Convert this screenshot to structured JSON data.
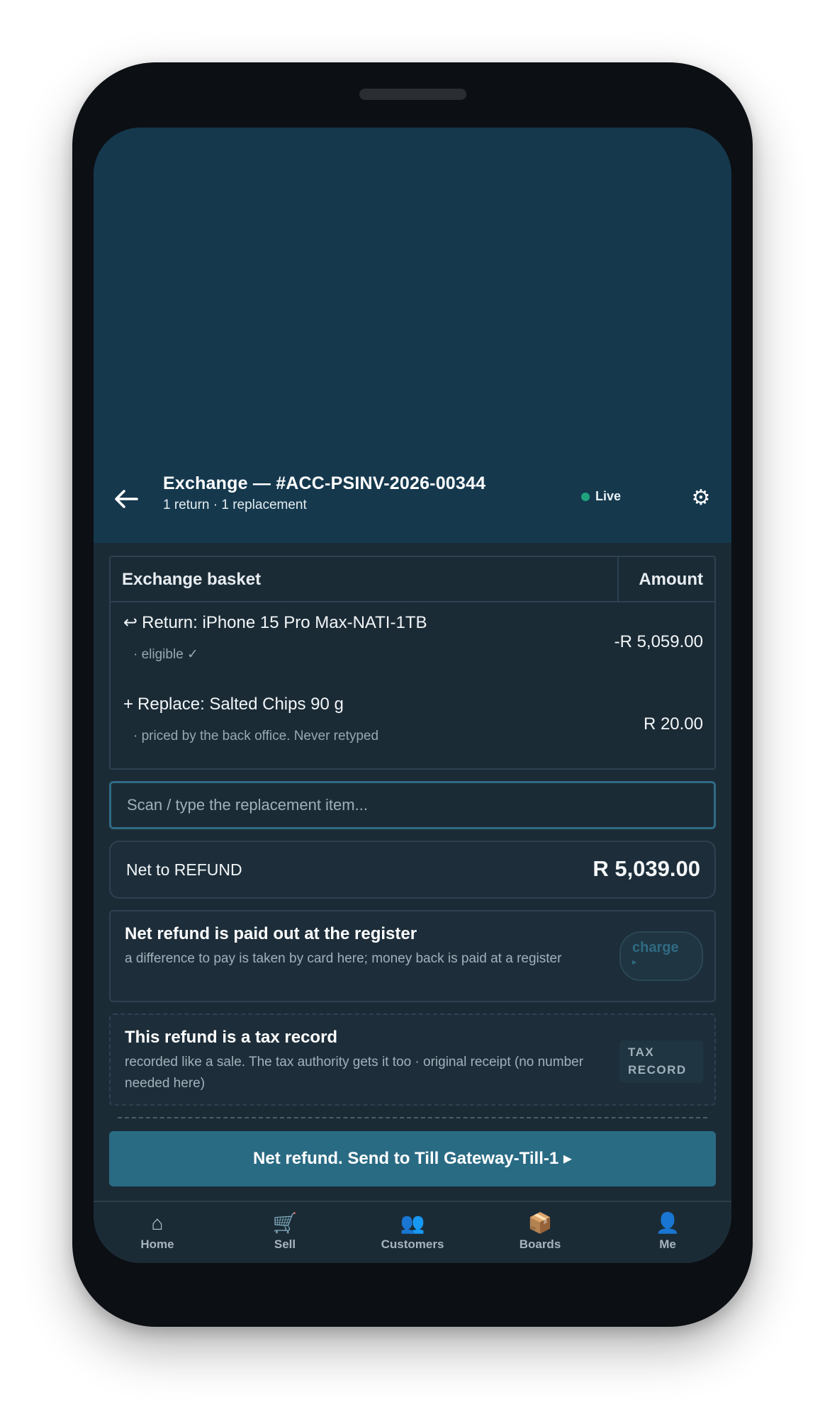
{
  "header": {
    "back_icon": "arrow-left-icon",
    "title": "Exchange — #ACC-PSINV-2026-00344",
    "subtitle": "1 return · 1 replacement",
    "status": "Live",
    "status_color": "#1fa37d",
    "settings_icon": "gear-icon"
  },
  "basket": {
    "header_label": "Exchange basket",
    "amount_label": "Amount",
    "rows": [
      {
        "glyph": "↩",
        "label": "Return: iPhone 15 Pro Max-NATI-1TB",
        "note": "· eligible ✓",
        "amount": "-R 5,059.00"
      },
      {
        "glyph": "+",
        "label": "Replace: Salted Chips 90 g",
        "note": "· priced by the back office. Never retyped",
        "amount": "R 20.00"
      }
    ]
  },
  "scan": {
    "placeholder": "Scan / type the replacement item...",
    "value": ""
  },
  "net": {
    "label": "Net to REFUND",
    "value": "R 5,039.00"
  },
  "payout_card": {
    "title": "Net refund is paid out at the register",
    "description": "a difference to pay is taken by card here; money back is paid at a register",
    "button_line1": "charge",
    "button_line2": "▸"
  },
  "tax_card": {
    "title": "This refund is a tax record",
    "description": "recorded like a sale. The tax authority gets it too · original receipt (no number needed here)",
    "badge_line1": "TAX",
    "badge_line2": "RECORD"
  },
  "cta": {
    "label": "Net refund. Send to Till Gateway-Till-1 ▸",
    "color": "#2a6b84"
  },
  "nav": {
    "items": [
      {
        "icon": "⌂",
        "icon_name": "home-icon",
        "label": "Home"
      },
      {
        "icon": "🛒",
        "icon_name": "cart-icon",
        "label": "Sell"
      },
      {
        "icon": "👥",
        "icon_name": "people-icon",
        "label": "Customers"
      },
      {
        "icon": "📦",
        "icon_name": "package-icon",
        "label": "Boards"
      },
      {
        "icon": "👤",
        "icon_name": "person-icon",
        "label": "Me"
      }
    ]
  }
}
